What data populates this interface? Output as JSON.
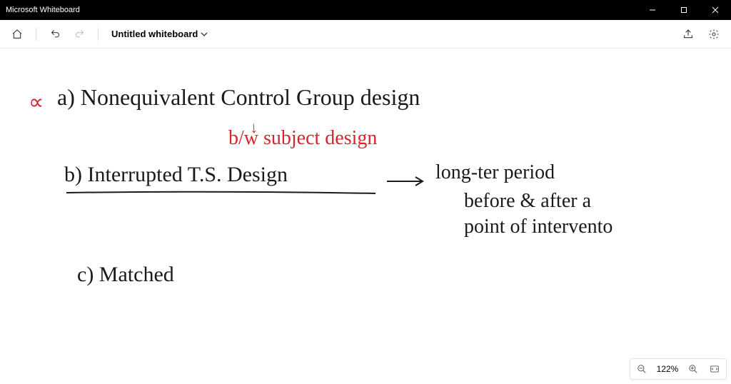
{
  "titlebar": {
    "app_name": "Microsoft Whiteboard"
  },
  "toolbar": {
    "board_name": "Untitled whiteboard"
  },
  "canvas": {
    "alpha_symbol": "∝",
    "line_a": "a)  Nonequivalent Control Group design",
    "line_a_sub": "b/w subject design",
    "line_b": "b)  Interrupted T.S. Design",
    "line_b_note1": "long-ter period",
    "line_b_note2": "before & after a",
    "line_b_note3": "point of intervento",
    "line_c": "c)   Matched",
    "arrow_b_sub": "↓"
  },
  "zoom": {
    "level": "122%"
  },
  "pen_colors": {
    "black": "#2b2b2b",
    "red": "#d6252c",
    "blue": "#1b5fc1",
    "yellow": "#f7e33b",
    "gray": "#8a8a8a"
  }
}
